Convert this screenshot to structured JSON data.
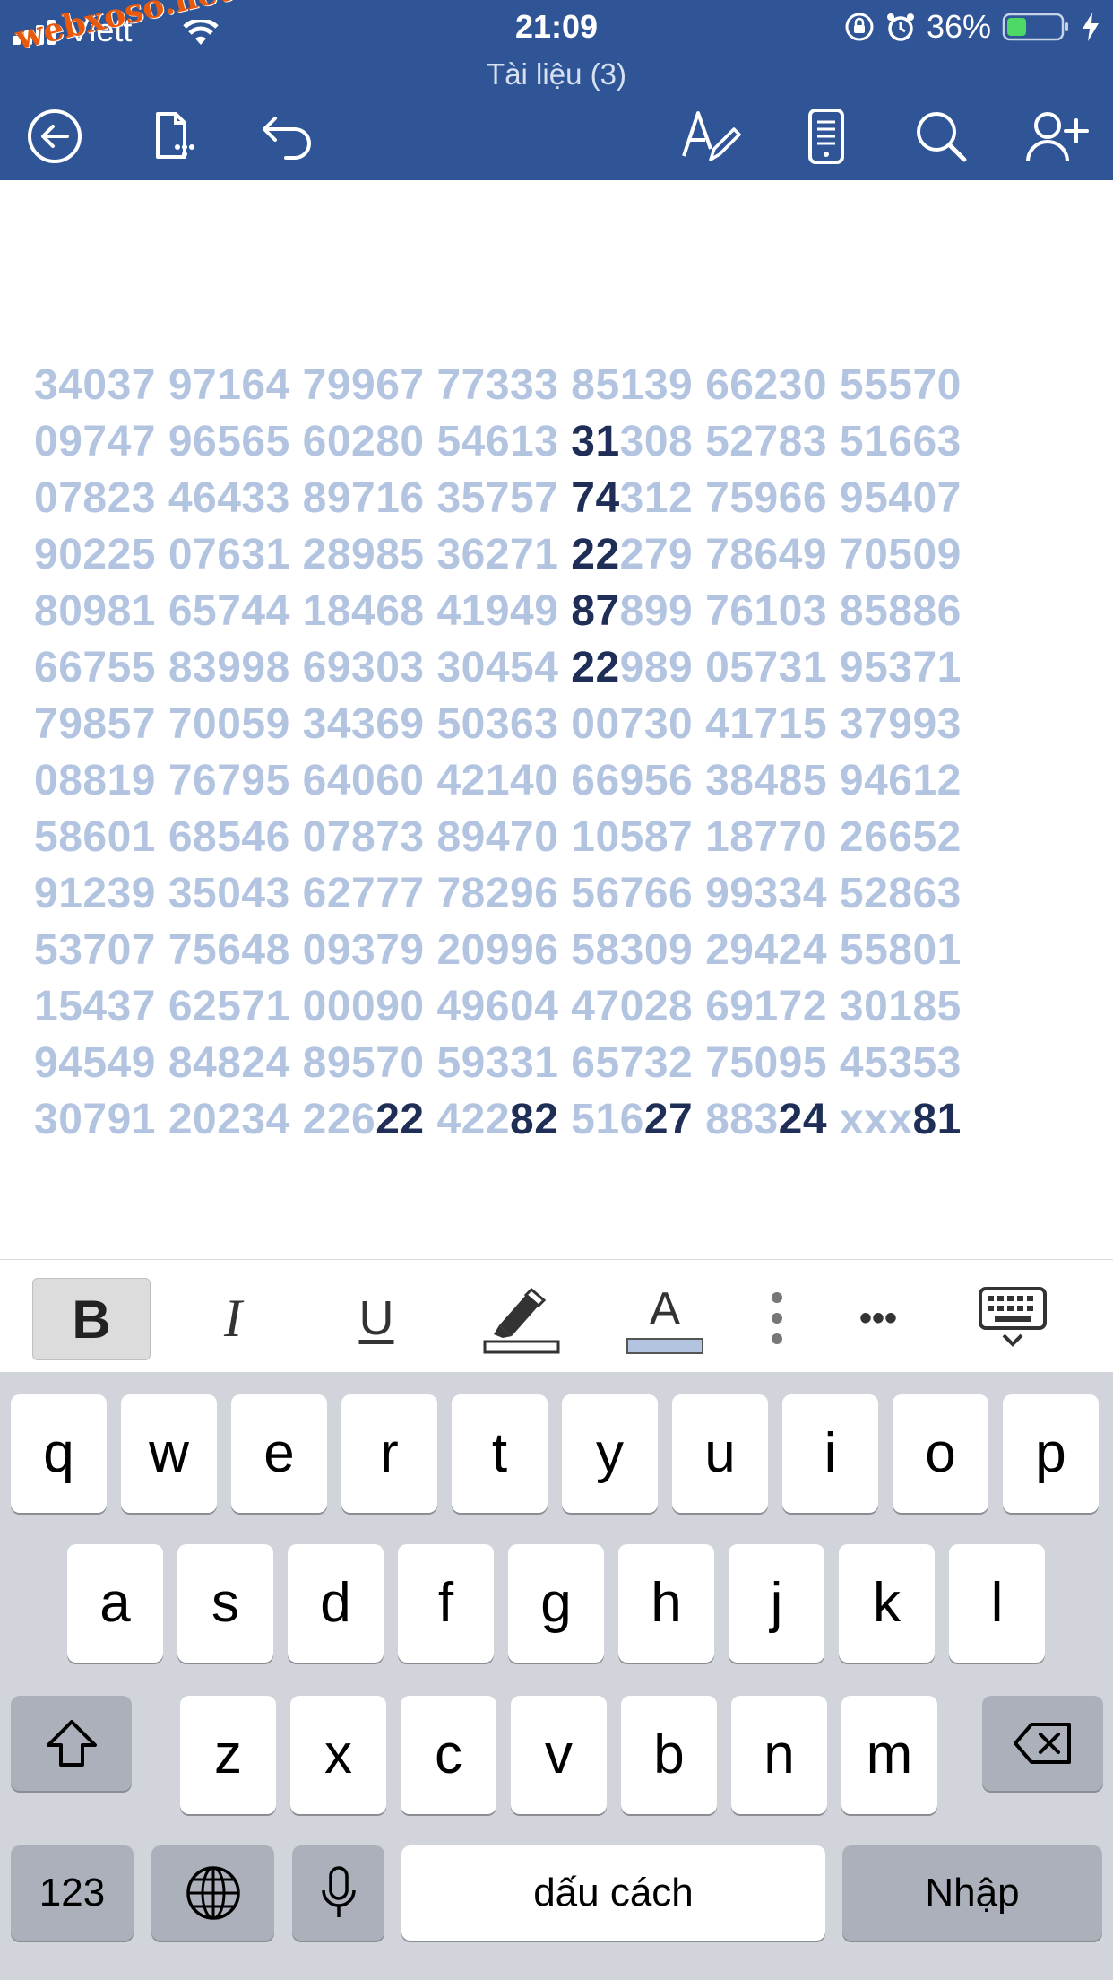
{
  "status_bar": {
    "carrier": "Viett",
    "watermark": "webxoso.net",
    "time": "21:09",
    "battery_percent": "36%",
    "battery_level": 0.36
  },
  "document_title": "Tài liệu (3)",
  "toolbar": {
    "icons": [
      "back-icon",
      "file-menu-icon",
      "undo-icon",
      "edit-pen-icon",
      "mobile-view-icon",
      "search-icon",
      "share-add-person-icon"
    ]
  },
  "document": {
    "lines": [
      [
        {
          "t": "34037 97164 79967 77333 85139 66230 55570",
          "h": false
        }
      ],
      [
        {
          "t": "09747 96565 60280 54613 ",
          "h": false
        },
        {
          "t": "31",
          "h": true
        },
        {
          "t": "308 52783 51663",
          "h": false
        }
      ],
      [
        {
          "t": "07823 46433 89716 35757 ",
          "h": false
        },
        {
          "t": "74",
          "h": true
        },
        {
          "t": "312 75966 95407",
          "h": false
        }
      ],
      [
        {
          "t": "90225 07631 28985 36271 ",
          "h": false
        },
        {
          "t": "22",
          "h": true
        },
        {
          "t": "279 78649 70509",
          "h": false
        }
      ],
      [
        {
          "t": "80981 65744 18468 41949 ",
          "h": false
        },
        {
          "t": "87",
          "h": true
        },
        {
          "t": "899 76103 85886",
          "h": false
        }
      ],
      [
        {
          "t": "66755 83998 69303 30454 ",
          "h": false
        },
        {
          "t": "22",
          "h": true
        },
        {
          "t": "989 05731 95371",
          "h": false
        }
      ],
      [
        {
          "t": "79857 70059 34369 50363 00730 41715 37993",
          "h": false
        }
      ],
      [
        {
          "t": "08819 76795 64060 42140 66956 38485 94612",
          "h": false
        }
      ],
      [
        {
          "t": "58601 68546 07873 89470 10587 18770 26652",
          "h": false
        }
      ],
      [
        {
          "t": "91239 35043 62777 78296 56766 99334 52863",
          "h": false
        }
      ],
      [
        {
          "t": "53707 75648 09379 20996 58309 29424 55801",
          "h": false
        }
      ],
      [
        {
          "t": "15437 62571 00090 49604 47028 69172 30185",
          "h": false
        }
      ],
      [
        {
          "t": "94549 84824 89570 59331 65732 75095 45353",
          "h": false
        }
      ],
      [
        {
          "t": "30791 20234 226",
          "h": false
        },
        {
          "t": "22",
          "h": true
        },
        {
          "t": " 422",
          "h": false
        },
        {
          "t": "82",
          "h": true
        },
        {
          "t": " 516",
          "h": false
        },
        {
          "t": "27",
          "h": true
        },
        {
          "t": " 883",
          "h": false
        },
        {
          "t": "24",
          "h": true
        },
        {
          "t": " xxx",
          "h": false
        },
        {
          "t": "81",
          "h": true
        }
      ]
    ]
  },
  "format_bar": {
    "bold_label": "B",
    "italic_label": "I",
    "underline_label": "U",
    "font_color_letter": "A",
    "font_color": "#B3C4E1",
    "more_label": "•••"
  },
  "keyboard": {
    "row1": [
      "q",
      "w",
      "e",
      "r",
      "t",
      "y",
      "u",
      "i",
      "o",
      "p"
    ],
    "row2": [
      "a",
      "s",
      "d",
      "f",
      "g",
      "h",
      "j",
      "k",
      "l"
    ],
    "row3": [
      "z",
      "x",
      "c",
      "v",
      "b",
      "n",
      "m"
    ],
    "numbers_label": "123",
    "space_label": "dấu cách",
    "return_label": "Nhập"
  },
  "colors": {
    "header_bg": "#2F5597",
    "text_faint": "#B3C4E1",
    "text_highlight": "#1E2E57",
    "keyboard_bg": "#D1D5DB"
  }
}
